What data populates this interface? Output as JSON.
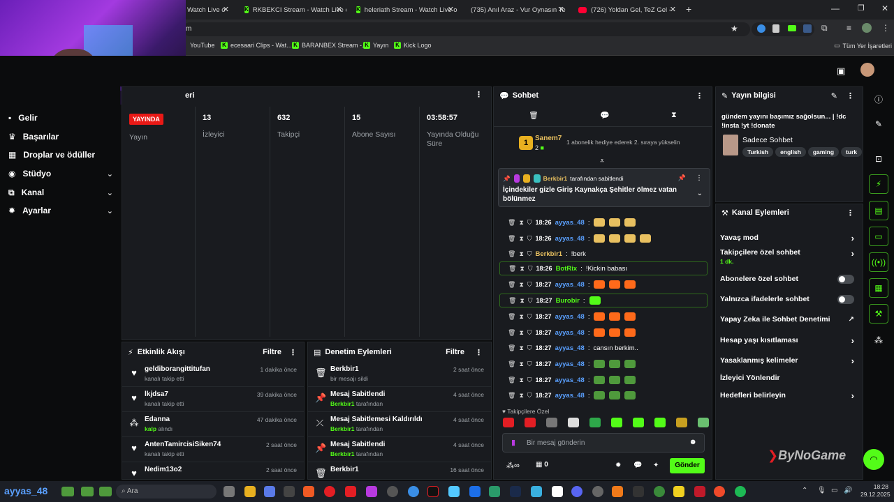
{
  "tabs": [
    {
      "label": "Watch Live o",
      "icon": "kick"
    },
    {
      "label": "RKBEKCI Stream - Watch Live o",
      "icon": "kick"
    },
    {
      "label": "heleriath Stream - Watch Live o",
      "icon": "kick"
    },
    {
      "label": "(735) Anıl Araz - Vur Oynasın Te",
      "icon": "youtube"
    },
    {
      "label": "(726) Yoldan Gel, TeZ Gel -",
      "icon": "youtube"
    }
  ],
  "url": "m",
  "bookmarks": [
    "YouTube",
    "ecesaari Clips - Wat...",
    "BARANBEX Stream -...",
    "Yayın",
    "Kick Logo"
  ],
  "all_bookmarks": "Tüm Yer İşaretleri",
  "sidebar": [
    {
      "label": "Gelir",
      "icon": "dollar-icon"
    },
    {
      "label": "Başarılar",
      "icon": "trophy-icon"
    },
    {
      "label": "Droplar ve ödüller",
      "icon": "gift-icon"
    },
    {
      "label": "Stüdyo",
      "icon": "studio-icon",
      "chevron": true
    },
    {
      "label": "Kanal",
      "icon": "channel-icon",
      "chevron": true
    },
    {
      "label": "Ayarlar",
      "icon": "gear-icon",
      "chevron": true
    }
  ],
  "stats_header": "eri",
  "stats": {
    "live_badge": "YAYINDA",
    "items": [
      {
        "value": "",
        "label": "Yayın"
      },
      {
        "value": "13",
        "label": "İzleyici"
      },
      {
        "value": "632",
        "label": "Takipçi"
      },
      {
        "value": "15",
        "label": "Abone Sayısı"
      },
      {
        "value": "03:58:57",
        "label": "Yayında Olduğu Süre"
      }
    ]
  },
  "activity": {
    "title": "Etkinlik Akışı",
    "filter": "Filtre",
    "items": [
      {
        "user": "geldiborangittitufan",
        "sub": "kanalı takip etti",
        "time": "1 dakika önce",
        "icon": "heart-icon"
      },
      {
        "user": "lkjdsa7",
        "sub": "kanalı takip etti",
        "time": "39 dakika önce",
        "icon": "heart-icon"
      },
      {
        "user": "Edanna",
        "sub_b": "kalp",
        "sub": " alındı",
        "time": "47 dakika önce",
        "icon": "kicks-icon"
      },
      {
        "user": "AntenTamircisiSiken74",
        "sub": "kanalı takip etti",
        "time": "2 saat önce",
        "icon": "heart-icon"
      },
      {
        "user": "Nedim13o2",
        "sub": "",
        "time": "2 saat önce",
        "icon": "heart-icon"
      }
    ]
  },
  "moderation": {
    "title": "Denetim Eylemleri",
    "filter": "Filtre",
    "items": [
      {
        "title": "Berkbir1",
        "sub": "bir mesajı sildi",
        "time": "2 saat önce",
        "icon": "trash-icon"
      },
      {
        "title": "Mesaj Sabitlendi",
        "sub_b": "Berkbir1",
        "sub": " tarafından",
        "time": "4 saat önce",
        "icon": "pin-icon"
      },
      {
        "title": "Mesaj Sabitlemesi Kaldırıldı",
        "sub_b": "Berkbir1",
        "sub": " tarafından",
        "time": "4 saat önce",
        "icon": "unpin-icon"
      },
      {
        "title": "Mesaj Sabitlendi",
        "sub_b": "Berkbir1",
        "sub": " tarafından",
        "time": "4 saat önce",
        "icon": "pin-icon"
      },
      {
        "title": "Berkbir1",
        "sub": "",
        "time": "16 saat önce",
        "icon": "trash-icon"
      }
    ]
  },
  "chat": {
    "title": "Sohbet",
    "gift_user": "Sanem7",
    "gift_count": "2",
    "gift_text": "1 abonelik hediye ederek 2. sıraya yükselin",
    "pinned_by": "Berkbir1",
    "pinned_suffix": "tarafından sabitlendi",
    "pinned_text": "İçindekiler gizle Giriş Kaynakça Şehitler ölmez vatan bölünmez",
    "messages": [
      {
        "time": "18:26",
        "user": "ayyas_48",
        "text": "",
        "emotes": 3,
        "emote_color": "#e8c060"
      },
      {
        "time": "18:26",
        "user": "ayyas_48",
        "text": "",
        "emotes": 4,
        "emote_color": "#e8c060"
      },
      {
        "time": "",
        "user": "Berkbir1",
        "text": "!berk",
        "user_color": "#e8c060",
        "emotes": 0
      },
      {
        "time": "18:26",
        "user": "BotRix",
        "text": "!Kickin babası",
        "user_color": "#53fc18",
        "emotes": 0,
        "highlight": true
      },
      {
        "time": "18:27",
        "user": "ayyas_48",
        "text": "",
        "emotes": 3,
        "emote_color": "#ff6a1a"
      },
      {
        "time": "18:27",
        "user": "Burobir",
        "text": "",
        "user_color": "#53fc18",
        "emotes": 1,
        "emote_color": "#53fc18",
        "highlight": true
      },
      {
        "time": "18:27",
        "user": "ayyas_48",
        "text": "",
        "emotes": 3,
        "emote_color": "#ff6a1a"
      },
      {
        "time": "18:27",
        "user": "ayyas_48",
        "text": "",
        "emotes": 3,
        "emote_color": "#ff6a1a"
      },
      {
        "time": "18:27",
        "user": "ayyas_48",
        "text": "cansın berkim..",
        "emotes": 0
      },
      {
        "time": "18:27",
        "user": "ayyas_48",
        "text": "",
        "emotes": 3,
        "emote_color": "#4f9a3c"
      },
      {
        "time": "18:27",
        "user": "ayyas_48",
        "text": "",
        "emotes": 3,
        "emote_color": "#4f9a3c"
      },
      {
        "time": "18:27",
        "user": "ayyas_48",
        "text": "",
        "emotes": 3,
        "emote_color": "#4f9a3c"
      }
    ],
    "followers_only": "Takipçilere Özel",
    "input_placeholder": "Bir mesaj gönderin",
    "points": "0",
    "send": "Gönder"
  },
  "stream_info": {
    "title": "Yayın bilgisi",
    "text": "gündem yayını başımız sağolsun... | !dc !insta !yt !donate",
    "category": "Sadece Sohbet",
    "tags": [
      "Turkish",
      "english",
      "gaming",
      "turk"
    ]
  },
  "channel_actions": {
    "title": "Kanal Eylemleri",
    "items": [
      {
        "label": "Yavaş mod",
        "type": "chevron"
      },
      {
        "label": "Takipçilere özel sohbet",
        "sub": "1 dk.",
        "type": "chevron"
      },
      {
        "label": "Abonelere özel sohbet",
        "type": "toggle"
      },
      {
        "label": "Yalnızca ifadelerle sohbet",
        "type": "toggle"
      },
      {
        "label": "Yapay Zeka ile Sohbet Denetimi",
        "type": "external"
      },
      {
        "label": "Hesap yaşı kısıtlaması",
        "type": "chevron"
      },
      {
        "label": "Yasaklanmış kelimeler",
        "type": "chevron"
      },
      {
        "label": "İzleyici Yönlendir",
        "type": "none"
      },
      {
        "label": "Hedefleri belirleyin",
        "type": "chevron"
      }
    ]
  },
  "watermark": "ByNoGame",
  "taskbar": {
    "user": "ayyas_48",
    "search": "Ara",
    "time": "18:28",
    "date": "29.12.2025"
  }
}
